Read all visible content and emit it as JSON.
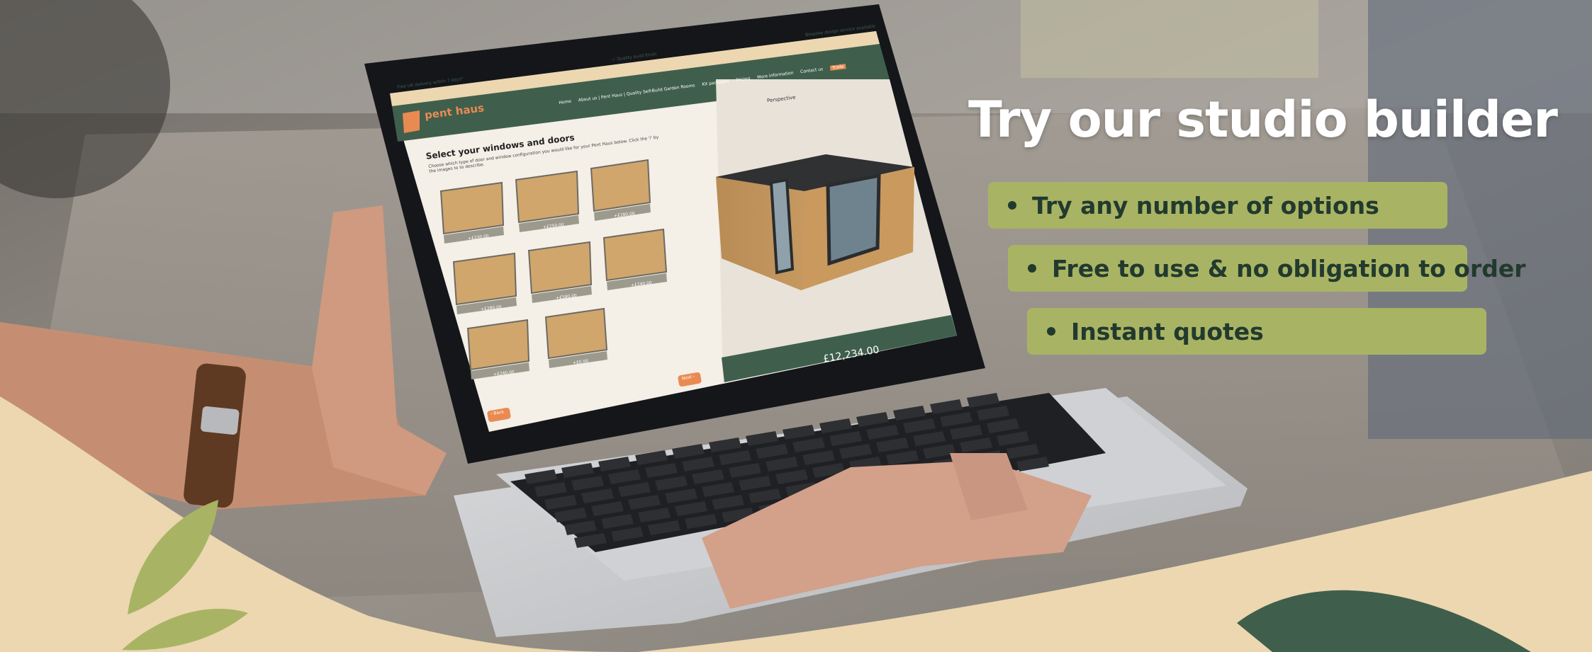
{
  "headline": "Try our studio builder",
  "bullets": [
    "Try any number of options",
    "Free to use & no obligation to order",
    "Instant quotes"
  ],
  "screen": {
    "promo_left": "Free UK delivery within 7 days*",
    "promo_center": "✓ Quality build finish",
    "promo_right": "Bespoke design service available",
    "brand": "pent haus",
    "nav": [
      "Home",
      "About us | Pent Haus | Quality Self-Build Garden Rooms",
      "Kit packages",
      "Pricing",
      "More information",
      "Contact us"
    ],
    "nav_button": "Trade",
    "section_title": "Select your windows and doors",
    "section_desc": "Choose which type of door and window configuration you would like for your Pent Haus below. Click the 'i' by the images to to describe.",
    "options": [
      "+£230.00",
      "+£250.00",
      "+£280.00",
      "+£280.00",
      "+£580.00",
      "+£240.00",
      "+£240.00",
      "+£0.00"
    ],
    "view_label": "Perspective",
    "next_button": "Next ›",
    "back_button": "‹ Back",
    "price": "£12,234.00"
  },
  "colors": {
    "brand_green": "#3f5f4c",
    "cream": "#ecd7b1",
    "accent_olive": "#a8b464",
    "button_orange": "#e98a52"
  }
}
